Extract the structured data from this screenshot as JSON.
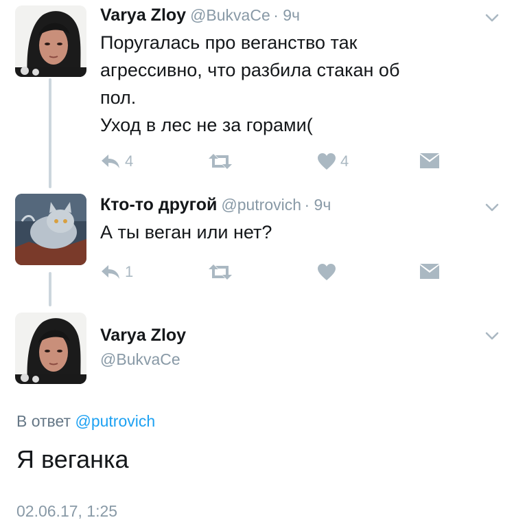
{
  "tweet1": {
    "name": "Varya Zloy",
    "handle": "@BukvaCe",
    "time": "· 9ч",
    "text": "Поругалась про веганство так\nагрессивно, что разбила стакан об\nпол.\nУход в лес не за горами(",
    "reply_count": "4",
    "like_count": "4"
  },
  "tweet2": {
    "name": "Кто-то другой",
    "handle": "@putrovich",
    "time": "· 9ч",
    "text": "А ты веган или нет?",
    "reply_count": "1"
  },
  "tweet3": {
    "name": "Varya Zloy",
    "handle": "@BukvaCe",
    "reply_label": "В ответ",
    "reply_mention": "@putrovich",
    "text": "Я веганка",
    "timestamp": "02.06.17, 1:25"
  },
  "colors": {
    "accent": "#1da1f2",
    "icon": "#aab8c2",
    "muted": "#8899a6"
  }
}
